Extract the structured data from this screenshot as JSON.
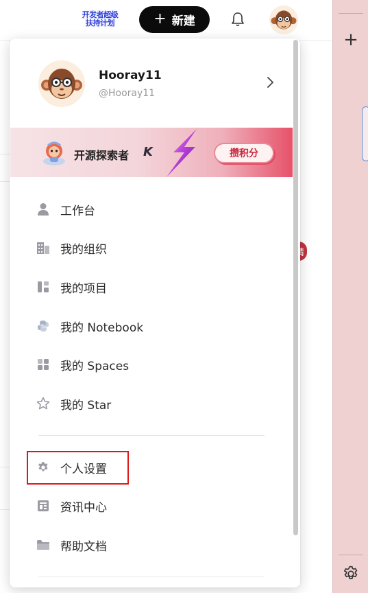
{
  "topbar": {
    "promo_badge_line1": "开发者超级",
    "promo_badge_line2": "扶持计划",
    "new_button_label": "新建",
    "new_button_icon": "plus-icon",
    "bell_icon": "bell-icon",
    "avatar_icon": "monkey-avatar"
  },
  "background": {
    "red_badge_text": "请"
  },
  "right_panel": {
    "plus_icon": "plus-icon",
    "gear_icon": "gear-icon"
  },
  "dropdown": {
    "profile": {
      "username": "Hooray11",
      "handle": "@Hooray11",
      "chevron": "chevron-right-icon"
    },
    "banner": {
      "title": "开源探索者",
      "k_logo": "K",
      "button": "攒积分"
    },
    "menu": [
      {
        "label": "工作台",
        "icon": "person-icon"
      },
      {
        "label": "我的组织",
        "icon": "building-icon"
      },
      {
        "label": "我的项目",
        "icon": "project-icon"
      },
      {
        "label": "我的 Notebook",
        "icon": "python-icon"
      },
      {
        "label": "我的 Spaces",
        "icon": "spaces-icon"
      },
      {
        "label": "我的 Star",
        "icon": "star-icon"
      },
      {
        "label": "个人设置",
        "icon": "gear-icon"
      },
      {
        "label": "资讯中心",
        "icon": "news-icon"
      },
      {
        "label": "帮助文档",
        "icon": "folder-icon"
      }
    ]
  },
  "colors": {
    "accent_black": "#0b0b0b",
    "banner_pink": "#e6526a",
    "highlight_red": "#e01616",
    "right_panel": "#efd1d1",
    "icon_gray": "#9a9aa3"
  }
}
